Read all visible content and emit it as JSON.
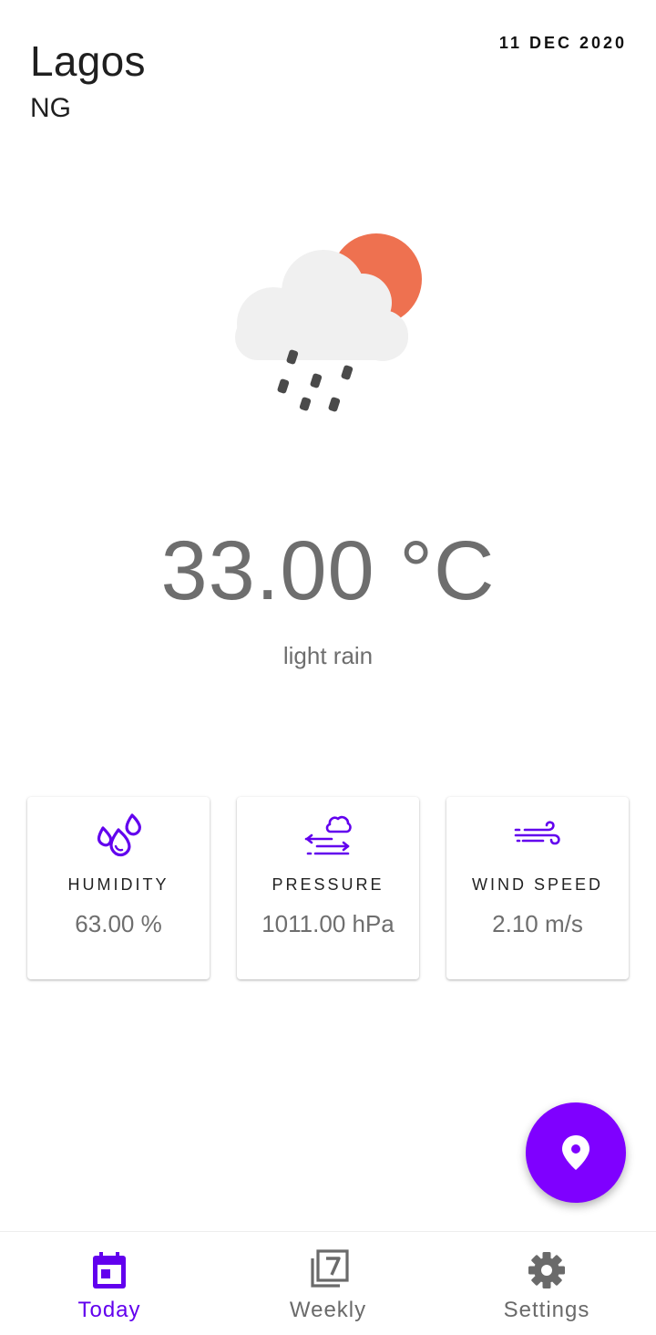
{
  "location": {
    "city": "Lagos",
    "country": "NG"
  },
  "date": "11 DEC 2020",
  "current": {
    "icon": "cloud-sun-rain-icon",
    "temperature": "33.00 °C",
    "description": "light rain"
  },
  "stats": [
    {
      "label": "HUMIDITY",
      "value": "63.00 %",
      "icon": "humidity-drops-icon"
    },
    {
      "label": "PRESSURE",
      "value": "1011.00 hPa",
      "icon": "pressure-icon"
    },
    {
      "label": "WIND SPEED",
      "value": "2.10 m/s",
      "icon": "wind-icon"
    }
  ],
  "fab": {
    "icon": "location-pin-icon"
  },
  "nav": [
    {
      "label": "Today",
      "icon": "calendar-icon",
      "active": true
    },
    {
      "label": "Weekly",
      "icon": "weekly-seven-icon",
      "active": false
    },
    {
      "label": "Settings",
      "icon": "gear-icon",
      "active": false
    }
  ],
  "colors": {
    "accent": "#7f00ff",
    "active_nav": "#6200ee",
    "icon_purple": "#6200ee",
    "sun": "#ee7150",
    "cloud": "#f0f0f0",
    "text_secondary": "#6e6e6e"
  }
}
